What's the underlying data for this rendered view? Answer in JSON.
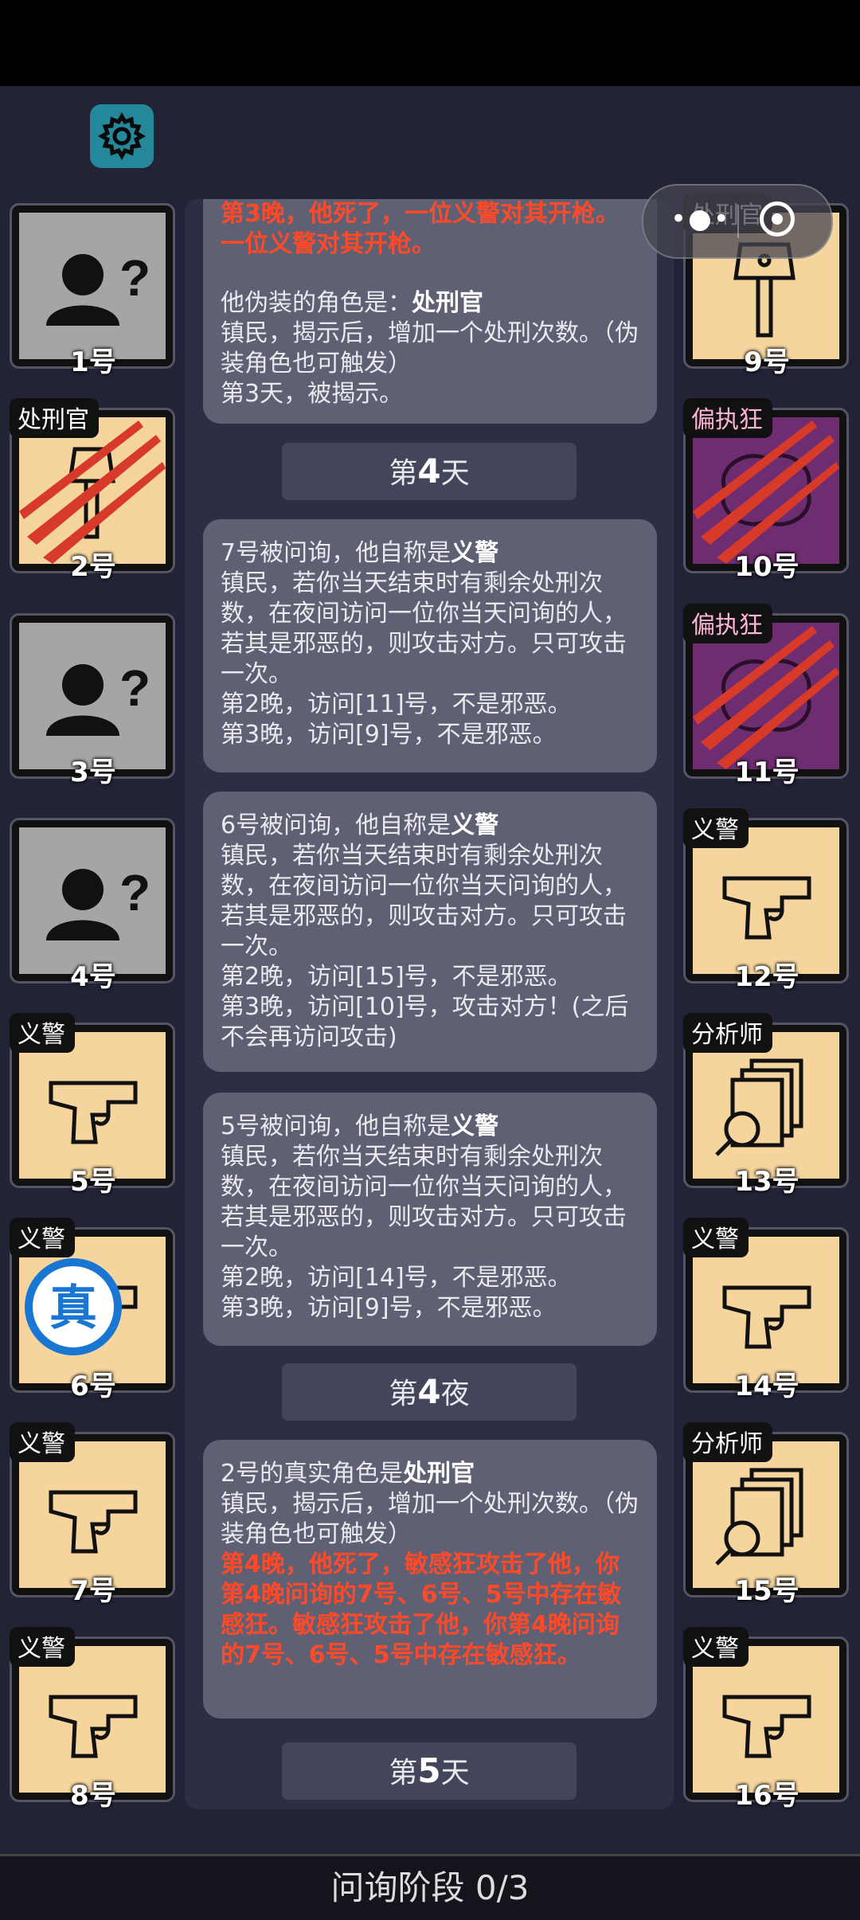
{
  "status_bar": {},
  "toolbar": {
    "settings_icon": "gear-icon",
    "menu_icon": "more-dots-icon",
    "close_icon": "target-icon"
  },
  "seats": [
    {
      "num": "1号",
      "role": "",
      "state": "unknown"
    },
    {
      "num": "2号",
      "role": "处刑官",
      "state": "dead-axe"
    },
    {
      "num": "3号",
      "role": "",
      "state": "unknown"
    },
    {
      "num": "4号",
      "role": "",
      "state": "unknown"
    },
    {
      "num": "5号",
      "role": "义警",
      "state": "gun"
    },
    {
      "num": "6号",
      "role": "义警",
      "state": "verified",
      "stamp": "真"
    },
    {
      "num": "7号",
      "role": "义警",
      "state": "gun"
    },
    {
      "num": "8号",
      "role": "义警",
      "state": "gun"
    },
    {
      "num": "9号",
      "role": "处刑官",
      "state": "axe"
    },
    {
      "num": "10号",
      "role": "偏执狂",
      "state": "dead-evil"
    },
    {
      "num": "11号",
      "role": "偏执狂",
      "state": "dead-evil"
    },
    {
      "num": "12号",
      "role": "义警",
      "state": "gun"
    },
    {
      "num": "13号",
      "role": "分析师",
      "state": "docs"
    },
    {
      "num": "14号",
      "role": "义警",
      "state": "gun"
    },
    {
      "num": "15号",
      "role": "分析师",
      "state": "docs"
    },
    {
      "num": "16号",
      "role": "义警",
      "state": "gun"
    }
  ],
  "feed": {
    "card1": {
      "red": "第3晚，他死了，一位义警对其开枪。一位义警对其开枪。",
      "disguise_prefix": "他伪装的角色是：",
      "disguise_role": "处刑官",
      "body": "镇民，揭示后，增加一个处刑次数。（伪装角色也可触发）\n第3天，被揭示。"
    },
    "day4": {
      "pre": "第",
      "n": "4",
      "post": "天"
    },
    "card2": {
      "prefix": "7号被问询，他自称是",
      "role": "义警",
      "body": "镇民，若你当天结束时有剩余处刑次数，在夜间访问一位你当天问询的人，若其是邪恶的，则攻击对方。只可攻击一次。\n第2晚，访问[11]号，不是邪恶。\n第3晚，访问[9]号，不是邪恶。"
    },
    "card3": {
      "prefix": "6号被问询，他自称是",
      "role": "义警",
      "body": "镇民，若你当天结束时有剩余处刑次数，在夜间访问一位你当天问询的人，若其是邪恶的，则攻击对方。只可攻击一次。\n第2晚，访问[15]号，不是邪恶。\n第3晚，访问[10]号，攻击对方！(之后不会再访问攻击)"
    },
    "card4": {
      "prefix": "5号被问询，他自称是",
      "role": "义警",
      "body": "镇民，若你当天结束时有剩余处刑次数，在夜间访问一位你当天问询的人，若其是邪恶的，则攻击对方。只可攻击一次。\n第2晚，访问[14]号，不是邪恶。\n第3晚，访问[9]号，不是邪恶。"
    },
    "night4": {
      "pre": "第",
      "n": "4",
      "post": "夜"
    },
    "card5": {
      "prefix": "2号的真实角色是",
      "role": "处刑官",
      "body": "镇民，揭示后，增加一个处刑次数。（伪装角色也可触发）",
      "red": "第4晚，他死了，敏感狂攻击了他，你第4晚问询的7号、6号、5号中存在敏感狂。敏感狂攻击了他，你第4晚问询的7号、6号、5号中存在敏感狂。"
    },
    "day5": {
      "pre": "第",
      "n": "5",
      "post": "天"
    }
  },
  "phase": "问询阶段 0/3"
}
